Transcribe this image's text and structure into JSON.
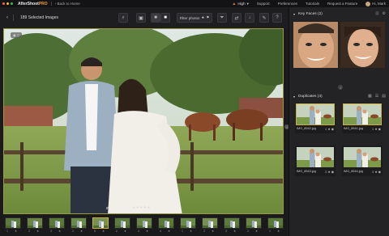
{
  "app": {
    "name": "AfterShoot",
    "edition": "PRO",
    "back_home": "Back to Home",
    "quality": "High",
    "menu": [
      "Support",
      "Preferences",
      "Tutorials",
      "Request a Feature"
    ],
    "user": "Hi, Mark"
  },
  "toolbar": {
    "back_label": "‹",
    "selected_count": "189 Selected Images",
    "filter_label": "Filter photos"
  },
  "main_photo": {
    "caption": "IMG_8542.jpg",
    "rating_stars": "★★★★★",
    "color_accent": "#9a9a40"
  },
  "filmstrip": {
    "items": [
      {
        "rating": "1"
      },
      {
        "rating": "2"
      },
      {
        "rating": "3"
      },
      {
        "rating": "2"
      },
      {
        "rating": "5"
      },
      {
        "rating": "2"
      },
      {
        "rating": "3"
      },
      {
        "rating": "4"
      },
      {
        "rating": "1"
      },
      {
        "rating": "2"
      },
      {
        "rating": "3"
      },
      {
        "rating": "2"
      },
      {
        "rating": "1"
      }
    ]
  },
  "key_faces": {
    "title": "Key Faces (2)"
  },
  "duplicates": {
    "title": "Duplicates (4)",
    "items": [
      {
        "name": "IMG_8542.jpg",
        "rating": "1"
      },
      {
        "name": "IMG_8541.jpg",
        "rating": "1"
      },
      {
        "name": "IMG_8543.jpg",
        "rating": "3"
      },
      {
        "name": "IMG_8544.jpg",
        "rating": "3"
      }
    ]
  },
  "colors": {
    "accent_yellow": "#c9b13a",
    "brand_orange": "#f0a030"
  }
}
